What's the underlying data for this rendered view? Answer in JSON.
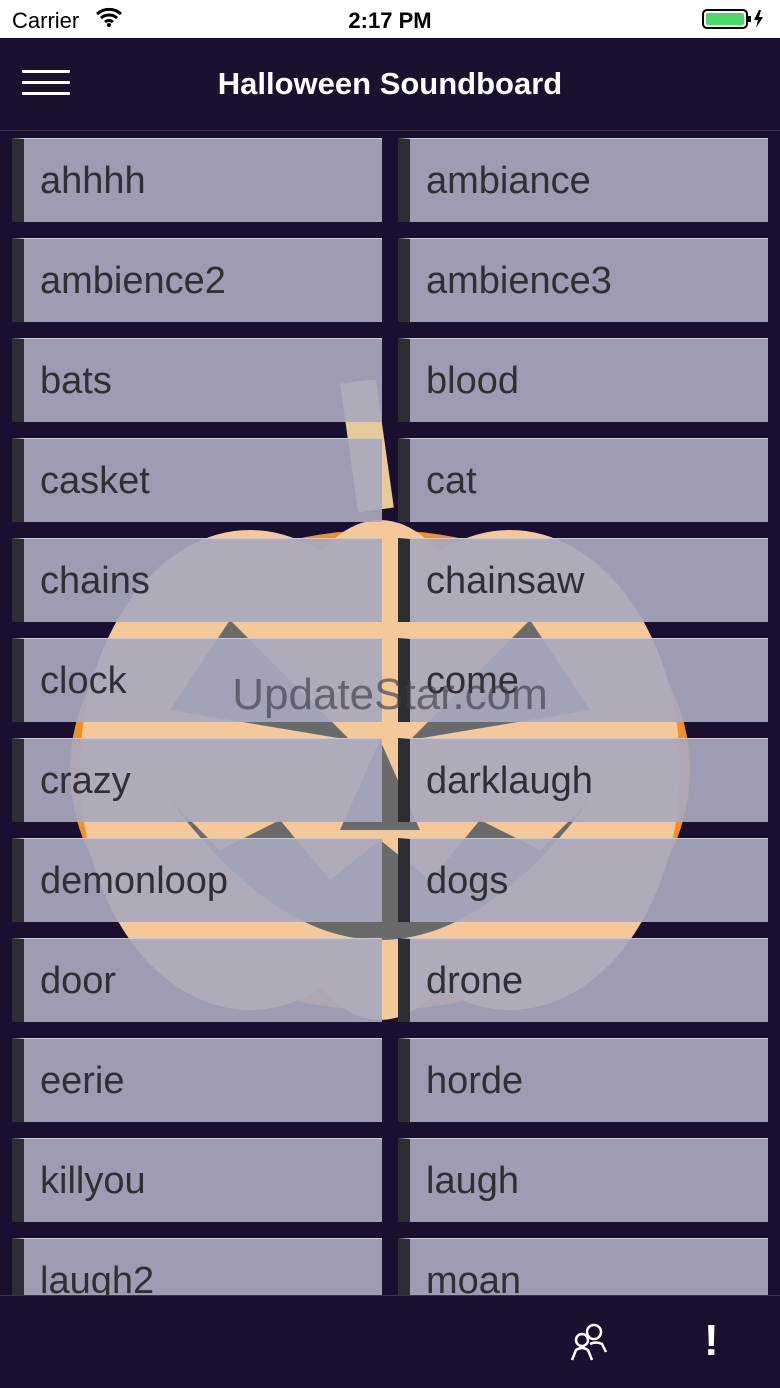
{
  "status_bar": {
    "carrier": "Carrier",
    "time": "2:17 PM"
  },
  "header": {
    "title": "Halloween Soundboard",
    "menu_icon": "hamburger-menu-icon"
  },
  "sounds": [
    "ahhhh",
    "ambiance",
    "ambience2",
    "ambience3",
    "bats",
    "blood",
    "casket",
    "cat",
    "chains",
    "chainsaw",
    "clock",
    "come",
    "crazy",
    "darklaugh",
    "demonloop",
    "dogs",
    "door",
    "drone",
    "eerie",
    "horde",
    "killyou",
    "laugh",
    "laugh2",
    "moan"
  ],
  "watermark": "UpdateStar.com",
  "tabbar": {
    "people_icon": "people-icon",
    "info_label": "!"
  },
  "colors": {
    "bar_bg": "#1c1030",
    "button_bg": "#a8a8be",
    "pumpkin": "#f5a050"
  }
}
